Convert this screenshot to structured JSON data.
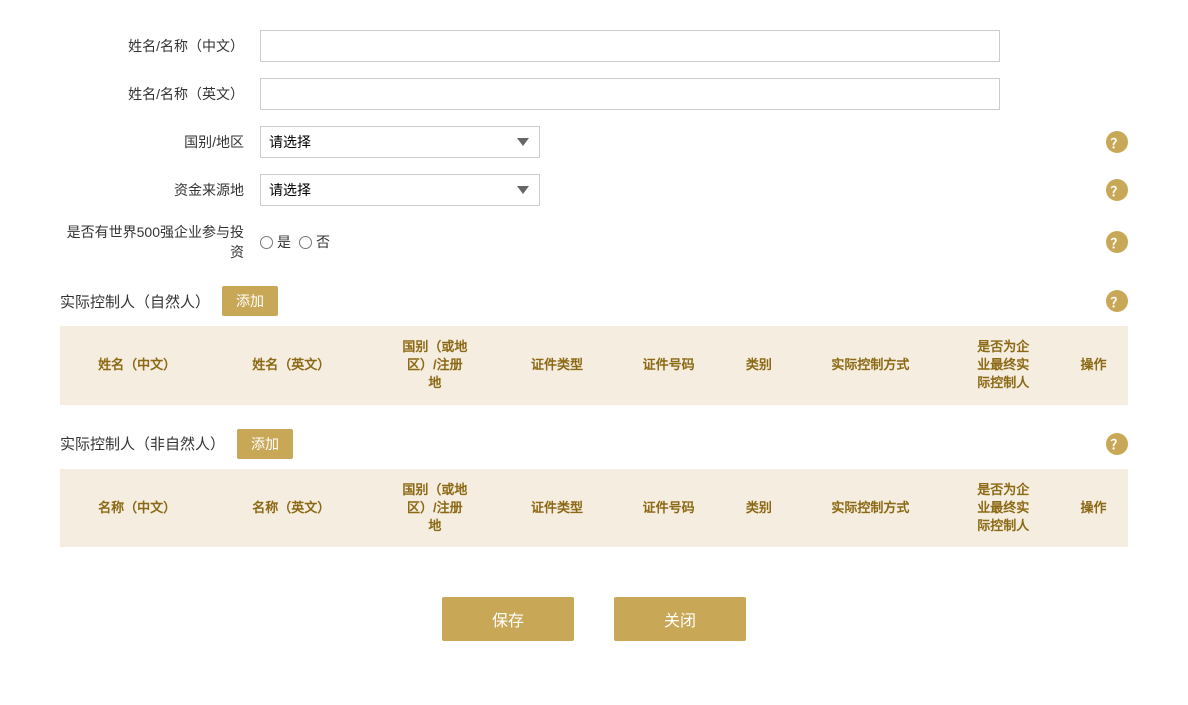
{
  "form": {
    "name_cn_label": "姓名/名称（中文）",
    "name_en_label": "姓名/名称（英文）",
    "country_label": "国别/地区",
    "country_placeholder": "请选择",
    "fund_source_label": "资金来源地",
    "fund_source_placeholder": "请选择",
    "fortune500_label": "是否有世界500强企业参与投资",
    "fortune500_yes": "是",
    "fortune500_no": "否",
    "name_cn_value": "",
    "name_en_value": ""
  },
  "natural_person_section": {
    "title": "实际控制人（自然人）",
    "add_label": "添加",
    "columns": [
      "姓名（中文）",
      "姓名（英文）",
      "国别（或地区）/注册地",
      "证件类型",
      "证件号码",
      "类别",
      "实际控制方式",
      "是否为企业最终实际控制人",
      "操作"
    ]
  },
  "non_natural_person_section": {
    "title": "实际控制人（非自然人）",
    "add_label": "添加",
    "columns": [
      "名称（中文）",
      "名称（英文）",
      "国别（或地区）/注册地",
      "证件类型",
      "证件号码",
      "类别",
      "实际控制方式",
      "是否为企业最终实际控制人",
      "操作"
    ]
  },
  "buttons": {
    "save_label": "保存",
    "close_label": "关闭"
  },
  "icons": {
    "help": "？",
    "dropdown": "▼"
  }
}
